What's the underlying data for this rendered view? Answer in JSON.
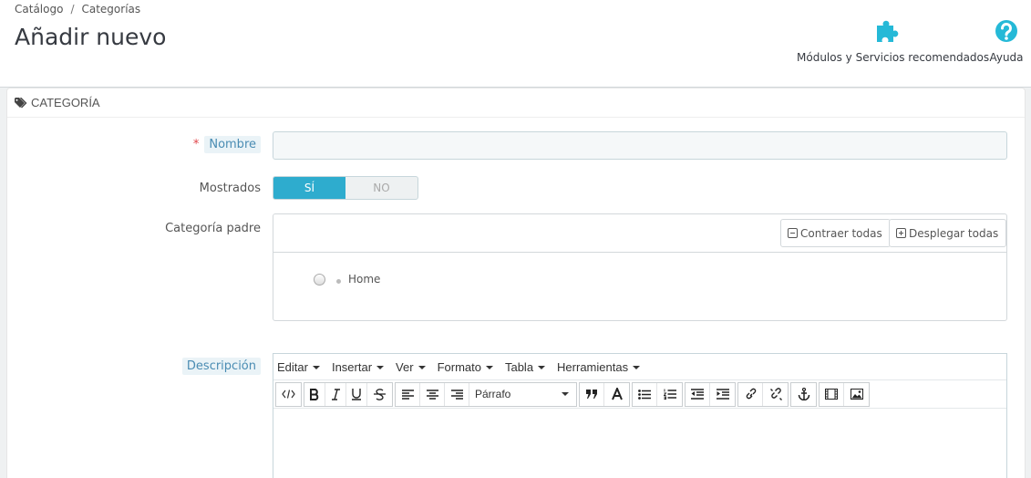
{
  "header": {
    "breadcrumb": [
      "Catálogo",
      "Categorías"
    ],
    "breadcrumb_separator": "/",
    "title": "Añadir nuevo",
    "toolbar": [
      {
        "label": "Módulos y Servicios recomendados",
        "icon": "puzzle-icon"
      },
      {
        "label": "Ayuda",
        "icon": "help-icon"
      }
    ]
  },
  "panel": {
    "heading": "CATEGORÍA",
    "heading_icon": "tags-icon",
    "fields": {
      "name": {
        "label": "Nombre",
        "required_mark": "*",
        "value": ""
      },
      "displayed": {
        "label": "Mostrados",
        "on_label": "SÍ",
        "off_label": "NO",
        "selected": "SÍ"
      },
      "parent": {
        "label": "Categoría padre",
        "collapse_label": "Contraer todas",
        "expand_label": "Desplegar todas",
        "tree_root": "Home"
      },
      "description": {
        "label": "Descripción"
      }
    }
  },
  "editor": {
    "menu": [
      "Editar",
      "Insertar",
      "Ver",
      "Formato",
      "Tabla",
      "Herramientas"
    ],
    "format_select": "Párrafo",
    "buttons": [
      "source-code",
      "bold",
      "italic",
      "underline",
      "strikethrough",
      "align-left",
      "align-center",
      "align-right",
      "blockquote",
      "text-color",
      "bullet-list",
      "numbered-list",
      "outdent",
      "indent",
      "link",
      "unlink",
      "anchor",
      "media",
      "image"
    ]
  },
  "colors": {
    "accent": "#2eacce",
    "required": "#e0464b",
    "label_help_bg": "#eaf3f7"
  }
}
